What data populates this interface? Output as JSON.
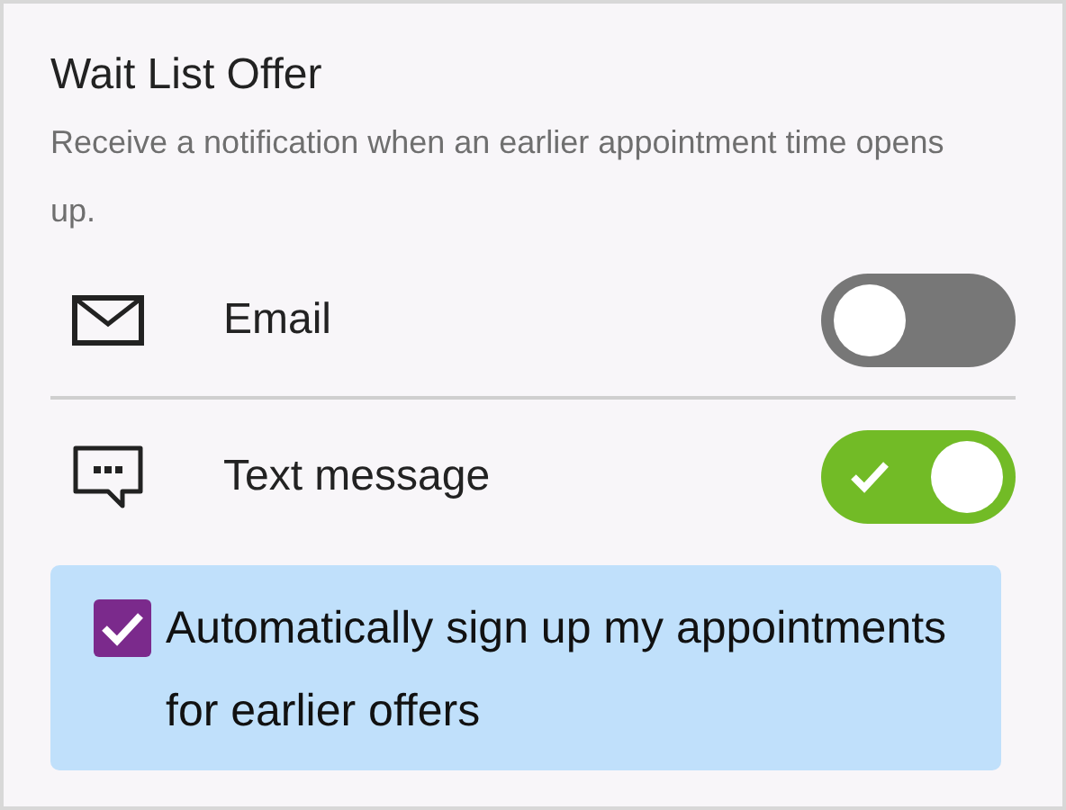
{
  "section": {
    "title": "Wait List Offer",
    "description": "Receive a notification when an earlier appointment time opens up."
  },
  "channels": [
    {
      "kind": "email",
      "label": "Email",
      "on": false
    },
    {
      "kind": "text",
      "label": "Text message",
      "on": true
    }
  ],
  "auto_signup": {
    "label": "Automatically sign up my appointments for earlier offers",
    "checked": true
  }
}
